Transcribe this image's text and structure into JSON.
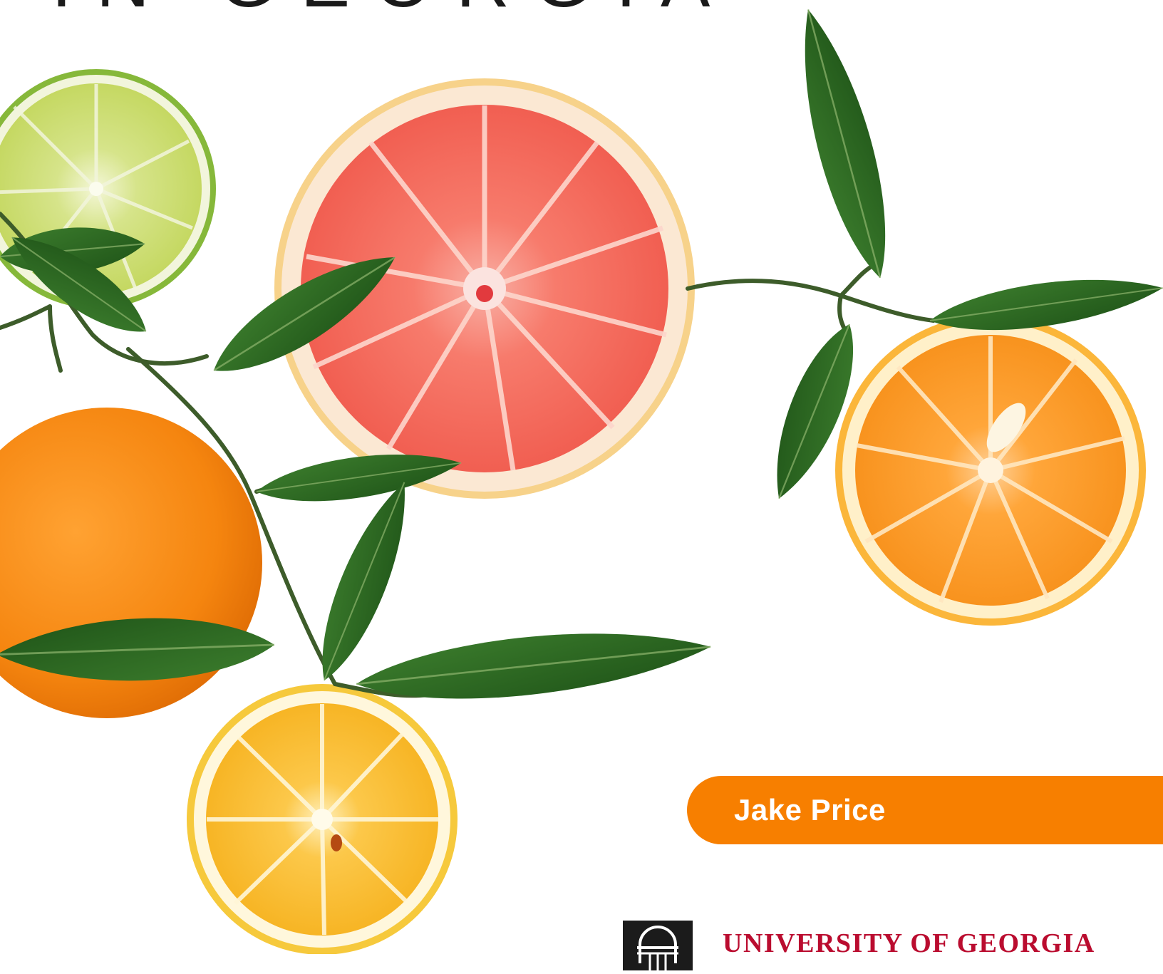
{
  "cover": {
    "title": "IN GEORGIA",
    "author": "Jake Price"
  },
  "publisher": {
    "name": "UNIVERSITY OF GEORGIA",
    "logo_icon": "arch-seal-icon"
  },
  "colors": {
    "accent_orange": "#f77f00",
    "publisher_red": "#ba0c2f",
    "leaf_green": "#2f6b26",
    "grapefruit_pink": "#f2655c",
    "orange_peel": "#f7921e",
    "lemon_yellow": "#f8b82a",
    "lime_green": "#c9dc6a"
  }
}
